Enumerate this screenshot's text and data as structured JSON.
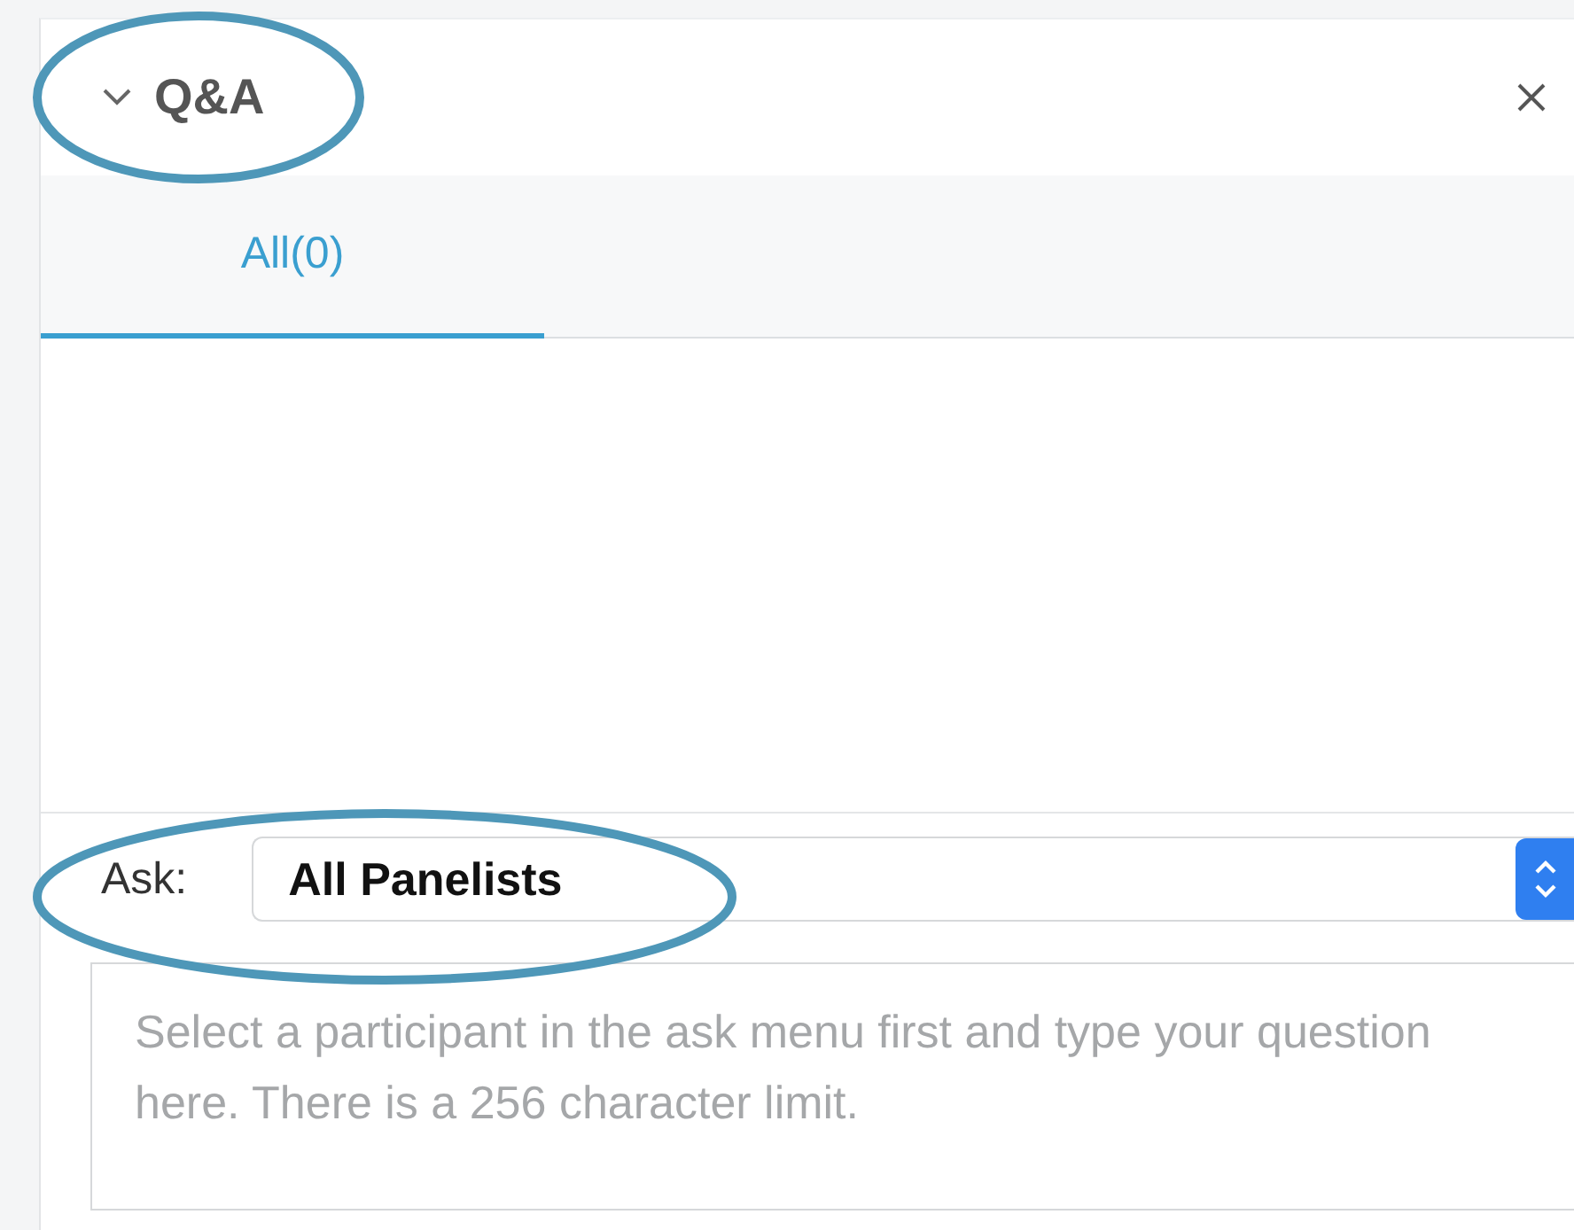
{
  "panel": {
    "title": "Q&A",
    "expanded": true
  },
  "tabs": [
    {
      "label": "All(0)",
      "selected": true
    }
  ],
  "ask": {
    "label": "Ask:",
    "value": "All Panelists"
  },
  "question": {
    "placeholder": "Select a participant in the ask menu first and type your question here. There is a 256 character limit."
  }
}
